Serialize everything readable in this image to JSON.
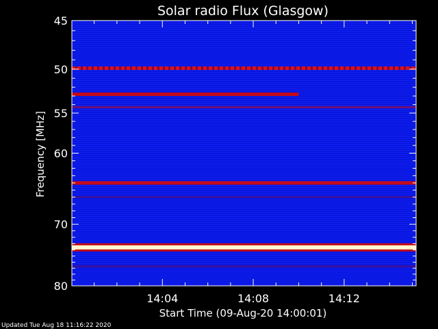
{
  "chart_data": {
    "type": "heatmap",
    "title": "Solar radio Flux (Glasgow)",
    "ylabel": "Frequency [MHz]",
    "xlabel": "Start Time (09-Aug-20 14:00:01)",
    "footer": "Updated Tue Aug 18 11:16:22 2020",
    "y_ticks": [
      "45",
      "50",
      "55",
      "60",
      "70",
      "80"
    ],
    "x_ticks": [
      "14:04",
      "14:08",
      "14:12"
    ],
    "ylim": [
      45,
      80
    ],
    "y_scale": "log",
    "xlim": [
      "14:00:01",
      "14:15:10"
    ],
    "x_tick_values": [
      "14:04",
      "14:08",
      "14:12"
    ],
    "background_color": "#0b16e6",
    "colors": {
      "low": "#0010e0",
      "mid": "#c40a1a",
      "high": "#fff8d0",
      "frame": "#ffffff"
    },
    "bands": [
      {
        "freq_mhz": 49.9,
        "level": "mid",
        "pattern": "dotted",
        "start": "14:00:01",
        "end": "14:15:10"
      },
      {
        "freq_mhz": 52.8,
        "level": "mid",
        "pattern": "solid",
        "start": "14:00:01",
        "end": "14:10:00"
      },
      {
        "freq_mhz": 54.3,
        "level": "mid",
        "pattern": "faint",
        "start": "14:00:01",
        "end": "14:15:10"
      },
      {
        "freq_mhz": 64.0,
        "level": "mid",
        "pattern": "solid",
        "start": "14:00:01",
        "end": "14:15:10"
      },
      {
        "freq_mhz": 66.0,
        "level": "low",
        "pattern": "faint",
        "start": "14:00:01",
        "end": "14:15:10"
      },
      {
        "freq_mhz": 73.6,
        "level": "high",
        "pattern": "solid",
        "start": "14:00:01",
        "end": "14:15:10"
      },
      {
        "freq_mhz": 76.7,
        "level": "low",
        "pattern": "faint",
        "start": "14:00:01",
        "end": "14:15:10"
      }
    ]
  }
}
